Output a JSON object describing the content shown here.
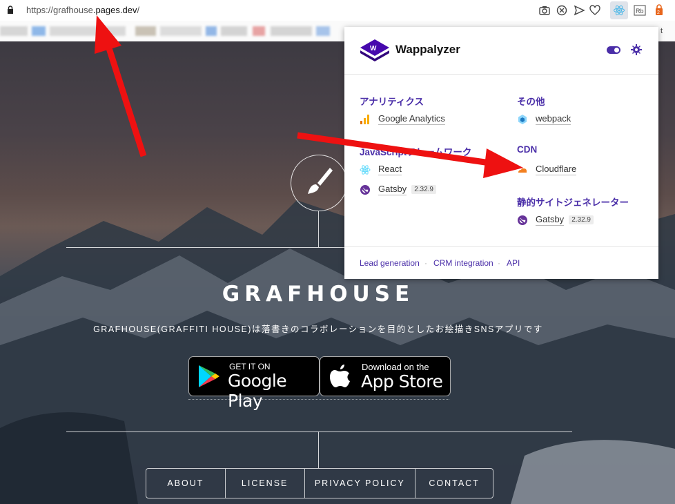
{
  "browser": {
    "url_prefix": "https://grafhouse",
    "url_domain": ".pages.dev",
    "url_suffix": "/",
    "toolbar_icons": [
      "camera-icon",
      "block-icon",
      "send-icon",
      "heart-icon",
      "wappalyzer-react-icon",
      "rb-icon",
      "extension-icon"
    ],
    "bookmark_trailing_text": "t"
  },
  "site": {
    "title": "GRAFHOUSE",
    "description": "GRAFHOUSE(GRAFFITI HOUSE)は落書きのコラボレーションを目的としたお絵描きSNSアプリです",
    "google_play": {
      "small": "GET IT ON",
      "big": "Google Play"
    },
    "app_store": {
      "small": "Download on the",
      "big": "App Store"
    },
    "nav": [
      "ABOUT",
      "LICENSE",
      "PRIVACY POLICY",
      "CONTACT"
    ]
  },
  "wappalyzer": {
    "name": "Wappalyzer",
    "categories": {
      "analytics": {
        "label": "アナリティクス",
        "techs": [
          {
            "name": "Google Analytics",
            "icon": "google-analytics-icon"
          }
        ]
      },
      "js_framework": {
        "label": "JavaScriptフレームワーク",
        "techs": [
          {
            "name": "React",
            "icon": "react-icon"
          },
          {
            "name": "Gatsby",
            "version": "2.32.9",
            "icon": "gatsby-icon"
          }
        ]
      },
      "other": {
        "label": "その他",
        "techs": [
          {
            "name": "webpack",
            "icon": "webpack-icon"
          }
        ]
      },
      "cdn": {
        "label": "CDN",
        "techs": [
          {
            "name": "Cloudflare",
            "icon": "cloudflare-icon"
          }
        ]
      },
      "ssg": {
        "label": "静的サイトジェネレーター",
        "techs": [
          {
            "name": "Gatsby",
            "version": "2.32.9",
            "icon": "gatsby-icon"
          }
        ]
      }
    },
    "footer_links": [
      "Lead generation",
      "CRM integration",
      "API"
    ],
    "footer_sep": "·"
  },
  "colors": {
    "accent": "#4a2ea8",
    "arrow": "#ee1111"
  }
}
